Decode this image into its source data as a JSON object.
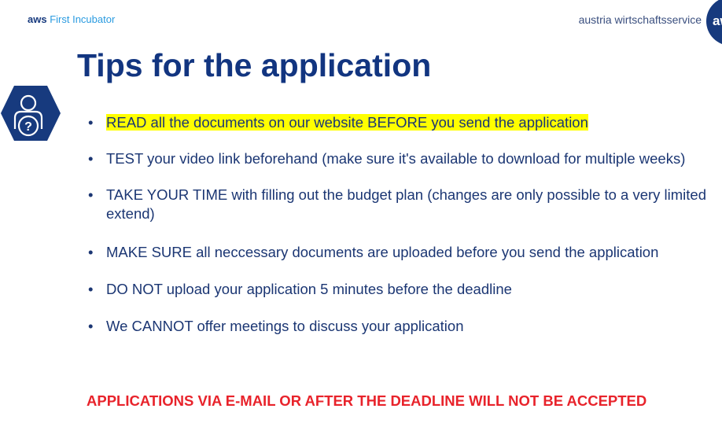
{
  "header": {
    "brand_bold": "aws",
    "brand_light": "First Incubator",
    "org": "austria wirtschaftsservice",
    "logo_text": "aw"
  },
  "title": "Tips for the application",
  "icon": "person-question-hexagon-icon",
  "bullets": [
    {
      "text": "READ all the documents on our website BEFORE you send the application",
      "highlight": true
    },
    {
      "text": "TEST your video link beforehand (make sure it's available to download for multiple weeks)"
    },
    {
      "text": "TAKE YOUR TIME with filling out the budget plan (changes are only possible to a very limited extend)"
    },
    {
      "text": "MAKE SURE all neccessary documents are uploaded before you send the application"
    },
    {
      "text": "DO NOT upload your application 5 minutes before the deadline"
    },
    {
      "text": "We CANNOT offer meetings to discuss your application"
    }
  ],
  "warning": "APPLICATIONS VIA E-MAIL OR AFTER THE DEADLINE WILL NOT BE ACCEPTED",
  "colors": {
    "navy": "#123580",
    "red": "#e8232b",
    "highlight": "#ffff00"
  }
}
